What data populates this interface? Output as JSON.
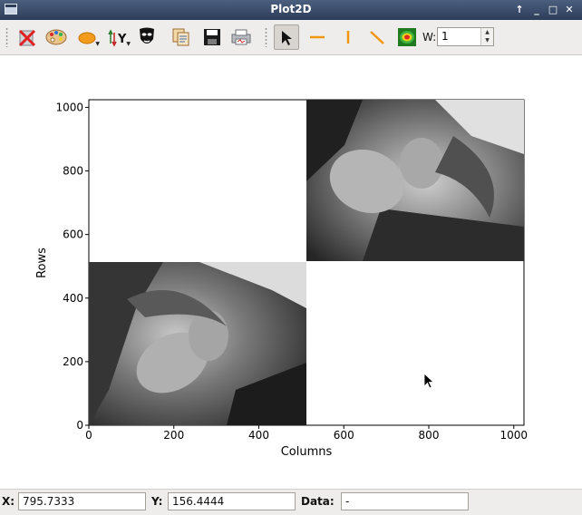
{
  "window": {
    "title": "Plot2D",
    "controls": [
      "↑",
      "_",
      "□",
      "✕"
    ]
  },
  "toolbar": {
    "buttons": [
      {
        "name": "clear-icon"
      },
      {
        "name": "colormap-icon"
      },
      {
        "name": "curve-style-icon"
      },
      {
        "name": "y-axis-icon",
        "label": "Y"
      },
      {
        "name": "mask-icon"
      },
      {
        "name": "copy-icon"
      },
      {
        "name": "save-icon"
      },
      {
        "name": "print-icon"
      },
      {
        "name": "select-arrow-icon"
      },
      {
        "name": "hline-icon"
      },
      {
        "name": "vline-icon"
      },
      {
        "name": "line-icon"
      },
      {
        "name": "heatmap-icon"
      }
    ],
    "width_label": "W:",
    "width_value": "1"
  },
  "plot": {
    "xlabel": "Columns",
    "ylabel": "Rows",
    "xticks": [
      "0",
      "200",
      "400",
      "600",
      "800",
      "1000"
    ],
    "yticks": [
      "0",
      "200",
      "400",
      "600",
      "800",
      "1000"
    ]
  },
  "chart_data": {
    "type": "heatmap",
    "xlabel": "Columns",
    "ylabel": "Rows",
    "xlim": [
      0,
      1024
    ],
    "ylim": [
      0,
      1024
    ],
    "grid": false,
    "colormap": "grayscale",
    "images": [
      {
        "x_range": [
          0,
          512
        ],
        "y_range": [
          0,
          512
        ],
        "orientation": "rotated"
      },
      {
        "x_range": [
          512,
          1024
        ],
        "y_range": [
          512,
          1024
        ],
        "orientation": "rotated"
      }
    ]
  },
  "status": {
    "x_label": "X:",
    "x_value": "795.7333",
    "y_label": "Y:",
    "y_value": "156.4444",
    "data_label": "Data:",
    "data_value": "-"
  }
}
